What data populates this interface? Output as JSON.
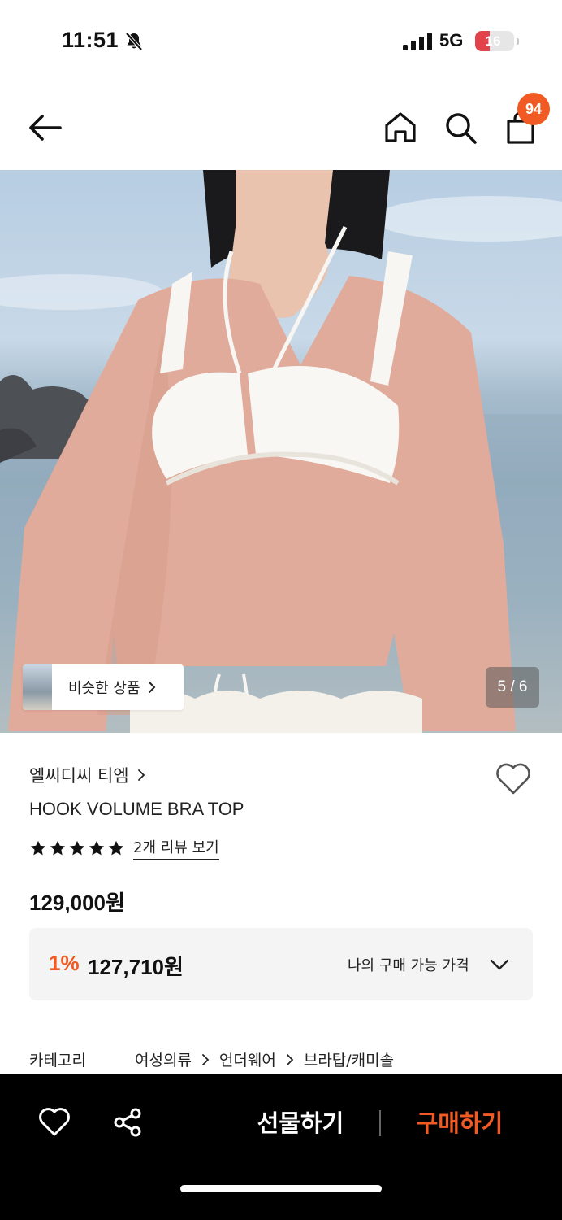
{
  "status_bar": {
    "time": "11:51",
    "network": "5G",
    "battery": "16",
    "icons": [
      "bell-off-icon",
      "signal-icon",
      "battery-icon"
    ]
  },
  "header": {
    "icons": [
      "back-arrow-icon",
      "home-icon",
      "search-icon",
      "shopping-bag-icon"
    ],
    "cart_count": "94"
  },
  "gallery": {
    "similar_label": "비슷한 상품",
    "page_indicator": "5 / 6"
  },
  "product": {
    "brand": "엘씨디씨 티엠",
    "name": "HOOK VOLUME BRA TOP",
    "rating_stars": 5,
    "review_link": "2개 리뷰 보기",
    "price": "129,000원",
    "discount_rate": "1%",
    "discount_price": "127,710원",
    "my_price_label": "나의 구매 가능 가격",
    "category_label": "카테고리",
    "category_path": [
      "여성의류",
      "언더웨어",
      "브라탑/캐미솔"
    ]
  },
  "bottom_bar": {
    "gift_label": "선물하기",
    "buy_label": "구매하기"
  },
  "colors": {
    "accent": "#f15a22",
    "bottom_bar_bg": "#000000",
    "price_box_bg": "#f4f4f4"
  }
}
